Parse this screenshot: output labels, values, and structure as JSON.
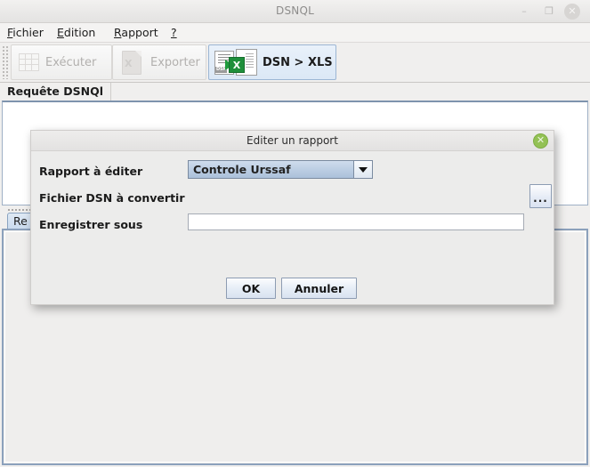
{
  "window": {
    "title": "DSNQL",
    "controls": {
      "minimize": {
        "name": "minimize-button",
        "glyph": "–"
      },
      "maximize": {
        "name": "maximize-button",
        "glyph": "❐"
      },
      "close": {
        "name": "close-button",
        "glyph": "✕"
      }
    }
  },
  "menubar": {
    "items": [
      {
        "mnemonic": "F",
        "rest": "ichier",
        "label": "Fichier"
      },
      {
        "mnemonic": "E",
        "rest": "dition",
        "label": "Edition"
      },
      {
        "mnemonic": "R",
        "rest": "apport",
        "label": "Rapport"
      },
      {
        "mnemonic": "?",
        "rest": "",
        "label": "?"
      }
    ]
  },
  "toolbar": {
    "buttons": [
      {
        "label": "Exécuter",
        "icon": "grid-run-icon",
        "enabled": false
      },
      {
        "label": "Exporter",
        "icon": "excel-export-icon",
        "enabled": false
      },
      {
        "label": "DSN > XLS",
        "icon": "dsn-to-xls-icon",
        "enabled": true,
        "selected": true
      }
    ],
    "dsn_tag": "DSN",
    "xls_tag": "X"
  },
  "editor": {
    "tab_label": "Requête DSNQl",
    "content": ""
  },
  "results_panel": {
    "tab_label": "Re"
  },
  "browse_button": {
    "label": "...",
    "name": "browse-ellipsis-button"
  },
  "dialog": {
    "title": "Editer un rapport",
    "close_glyph": "✕",
    "fields": {
      "rapport": {
        "label": "Rapport à éditer",
        "value": "Controle Urssaf",
        "options": [
          "Controle Urssaf"
        ]
      },
      "fichier_dsn": {
        "label": "Fichier DSN à convertir",
        "value": ""
      },
      "enregistrer": {
        "label": "Enregistrer sous",
        "value": "",
        "placeholder": ""
      }
    },
    "buttons": {
      "ok": "OK",
      "cancel": "Annuler"
    }
  },
  "colors": {
    "window_bg": "#f0efee",
    "dialog_bg": "#ececeb",
    "accent_blue": "#aac0da",
    "selected_toolbar": "#dbe8f6",
    "excel_green": "#1e8f3b",
    "dialog_close_green": "#93c154",
    "panel_border": "#8ca1bc"
  }
}
